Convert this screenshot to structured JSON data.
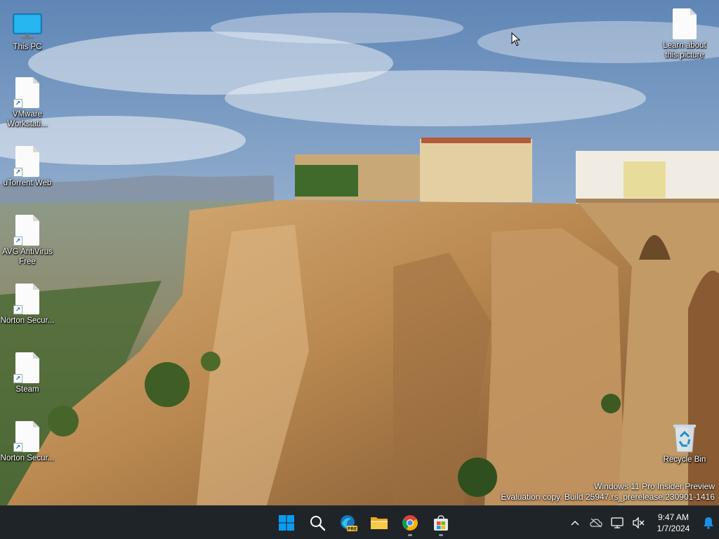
{
  "desktop": {
    "icons": [
      {
        "label": "This PC",
        "icon": "computer-monitor-icon"
      },
      {
        "label": "VMware Workstati...",
        "icon": "document-shortcut-icon"
      },
      {
        "label": "uTorrent Web",
        "icon": "document-shortcut-icon"
      },
      {
        "label": "AVG AntiVirus Free",
        "icon": "document-shortcut-icon"
      },
      {
        "label": "Norton Secur...",
        "icon": "document-shortcut-icon"
      },
      {
        "label": "Steam",
        "icon": "document-shortcut-icon"
      },
      {
        "label": "Norton Secur...",
        "icon": "document-shortcut-icon"
      }
    ],
    "right_icons": [
      {
        "label": "Learn about this picture",
        "icon": "document-icon"
      },
      {
        "label": "Recycle Bin",
        "icon": "recycle-bin-icon"
      }
    ],
    "watermark": {
      "line1": "Windows 11 Pro Insider Preview",
      "line2": "Evaluation copy. Build 25947.rs_prerelease.230901-1416"
    }
  },
  "taskbar": {
    "apps": [
      {
        "name": "Start",
        "icon": "windows-start-icon",
        "running": false
      },
      {
        "name": "Search",
        "icon": "search-icon",
        "running": false
      },
      {
        "name": "Microsoft Edge Preview",
        "icon": "edge-pre-icon",
        "running": false
      },
      {
        "name": "File Explorer",
        "icon": "folder-icon",
        "running": false
      },
      {
        "name": "Google Chrome",
        "icon": "chrome-icon",
        "running": true
      },
      {
        "name": "Microsoft Store",
        "icon": "store-icon",
        "running": true
      }
    ],
    "tray": {
      "icons": [
        "chevron-up-icon",
        "cloud-offline-icon",
        "network-icon",
        "volume-muted-icon"
      ],
      "time": "9:47 AM",
      "date": "1/7/2024",
      "notification_icon": "bell-icon"
    },
    "colors": {
      "background": "#1f2428",
      "accent": "#0078d4"
    }
  }
}
